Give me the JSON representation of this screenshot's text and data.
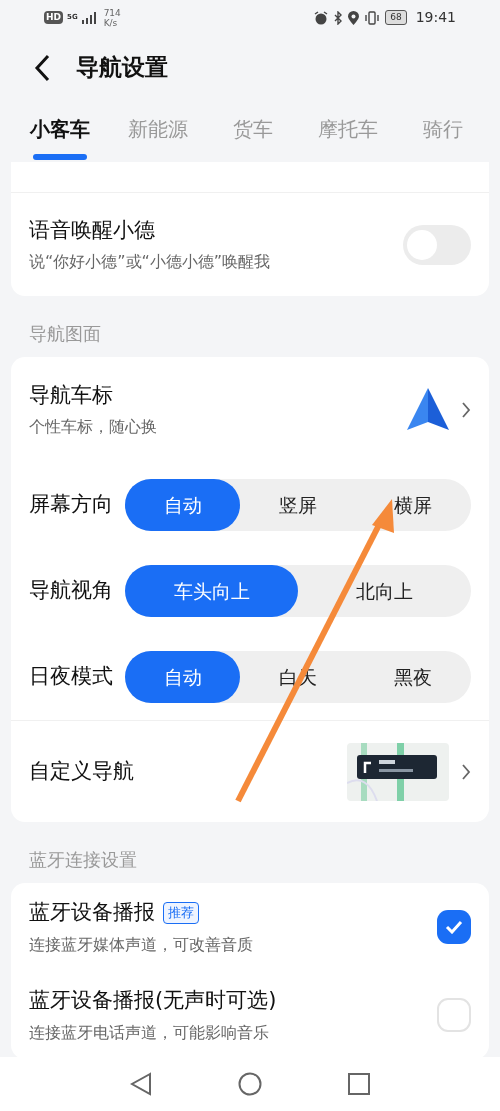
{
  "status_bar": {
    "hd": "HD",
    "network": "5G",
    "speed_value": "714",
    "speed_unit": "K/s",
    "battery": "68",
    "time": "19:41"
  },
  "header": {
    "title": "导航设置"
  },
  "tabs": [
    {
      "label": "小客车",
      "selected": true
    },
    {
      "label": "新能源",
      "selected": false
    },
    {
      "label": "货车",
      "selected": false
    },
    {
      "label": "摩托车",
      "selected": false
    },
    {
      "label": "骑行",
      "selected": false
    }
  ],
  "voice_card": {
    "items": [
      {
        "kind": "toggle",
        "title": "语音唤醒小德",
        "subtitle": "说“你好小德”或“小德小德”唤醒我",
        "on": false
      }
    ]
  },
  "sections": [
    {
      "label": "导航图面",
      "items": [
        {
          "kind": "icon",
          "title": "导航车标",
          "subtitle": "个性车标，随心换"
        },
        {
          "kind": "segmented",
          "title": "屏幕方向",
          "options": [
            {
              "label": "自动",
              "selected": true
            },
            {
              "label": "竖屏",
              "selected": false
            },
            {
              "label": "横屏",
              "selected": false
            }
          ]
        },
        {
          "kind": "segmented",
          "title": "导航视角",
          "options": [
            {
              "label": "车头向上",
              "selected": true
            },
            {
              "label": "北向上",
              "selected": false
            }
          ]
        },
        {
          "kind": "segmented",
          "title": "日夜模式",
          "options": [
            {
              "label": "自动",
              "selected": true
            },
            {
              "label": "白天",
              "selected": false
            },
            {
              "label": "黑夜",
              "selected": false
            }
          ]
        },
        {
          "kind": "preview",
          "title": "自定义导航"
        }
      ]
    },
    {
      "label": "蓝牙连接设置",
      "items": [
        {
          "kind": "checkbox",
          "title": "蓝牙设备播报",
          "badge": "推荐",
          "subtitle": "连接蓝牙媒体声道，可改善音质",
          "checked": true
        },
        {
          "kind": "checkbox",
          "title": "蓝牙设备播报(无声时可选)",
          "subtitle": "连接蓝牙电话声道，可能影响音乐",
          "checked": false
        }
      ]
    }
  ]
}
